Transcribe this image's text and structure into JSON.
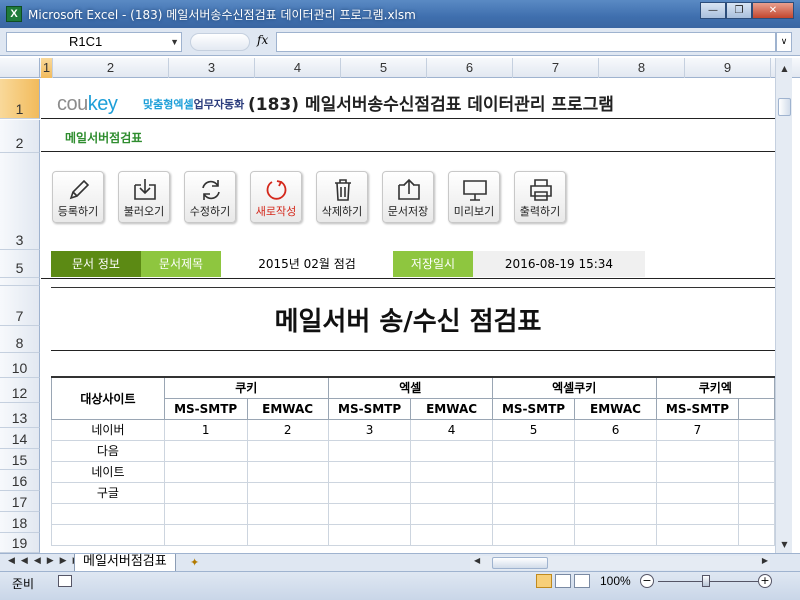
{
  "window": {
    "title": "Microsoft Excel - (183) 메일서버송수신점검표 데이터관리 프로그램.xlsm",
    "app_icon_letter": "X",
    "buttons": [
      "minimize",
      "restore",
      "close"
    ]
  },
  "formula_bar": {
    "name_box": "R1C1",
    "fx_label": "fx",
    "formula": ""
  },
  "columns": [
    "1",
    "2",
    "3",
    "4",
    "5",
    "6",
    "7",
    "8",
    "9"
  ],
  "rows": [
    "1",
    "2",
    "3",
    "5",
    "6",
    "7",
    "8",
    "10",
    "12",
    "13",
    "14",
    "15",
    "16",
    "17",
    "18",
    "19"
  ],
  "header": {
    "logo_main": "cou",
    "logo_key": "key",
    "logo_sub_1": "맞춤형엑셀",
    "logo_sub_2": "업무자동화",
    "title": "(183) 메일서버송수신점검표 데이터관리 프로그램",
    "subtitle": "메일서버점검표"
  },
  "toolbar": {
    "register": "등록하기",
    "load": "불러오기",
    "edit": "수정하기",
    "new": "새로작성",
    "delete": "삭제하기",
    "save": "문서저장",
    "preview": "미리보기",
    "print": "출력하기"
  },
  "info": {
    "doc_info_label": "문서 정보",
    "doc_title_label": "문서제목",
    "doc_title_value": "2015년 02월 점검",
    "saved_at_label": "저장일시",
    "saved_at_value": "2016-08-19 15:34"
  },
  "report_title": "메일서버 송/수신 점검표",
  "table": {
    "site_header": "대상사이트",
    "groups": [
      "쿠키",
      "엑셀",
      "엑셀쿠키",
      "쿠키엑"
    ],
    "subheaders": [
      "MS-SMTP",
      "EMWAC",
      "MS-SMTP",
      "EMWAC",
      "MS-SMTP",
      "EMWAC",
      "MS-SMTP"
    ],
    "rows": [
      {
        "site": "네이버",
        "values": [
          "1",
          "2",
          "3",
          "4",
          "5",
          "6",
          "7"
        ]
      },
      {
        "site": "다음",
        "values": [
          "",
          "",
          "",
          "",
          "",
          "",
          ""
        ]
      },
      {
        "site": "네이트",
        "values": [
          "",
          "",
          "",
          "",
          "",
          "",
          ""
        ]
      },
      {
        "site": "구글",
        "values": [
          "",
          "",
          "",
          "",
          "",
          "",
          ""
        ]
      },
      {
        "site": "",
        "values": [
          "",
          "",
          "",
          "",
          "",
          "",
          ""
        ]
      },
      {
        "site": "",
        "values": [
          "",
          "",
          "",
          "",
          "",
          "",
          ""
        ]
      }
    ]
  },
  "sheet_tabs": {
    "active": "메일서버점검표"
  },
  "status": {
    "ready": "준비",
    "zoom": "100%",
    "zoom_level_percent": 100
  }
}
